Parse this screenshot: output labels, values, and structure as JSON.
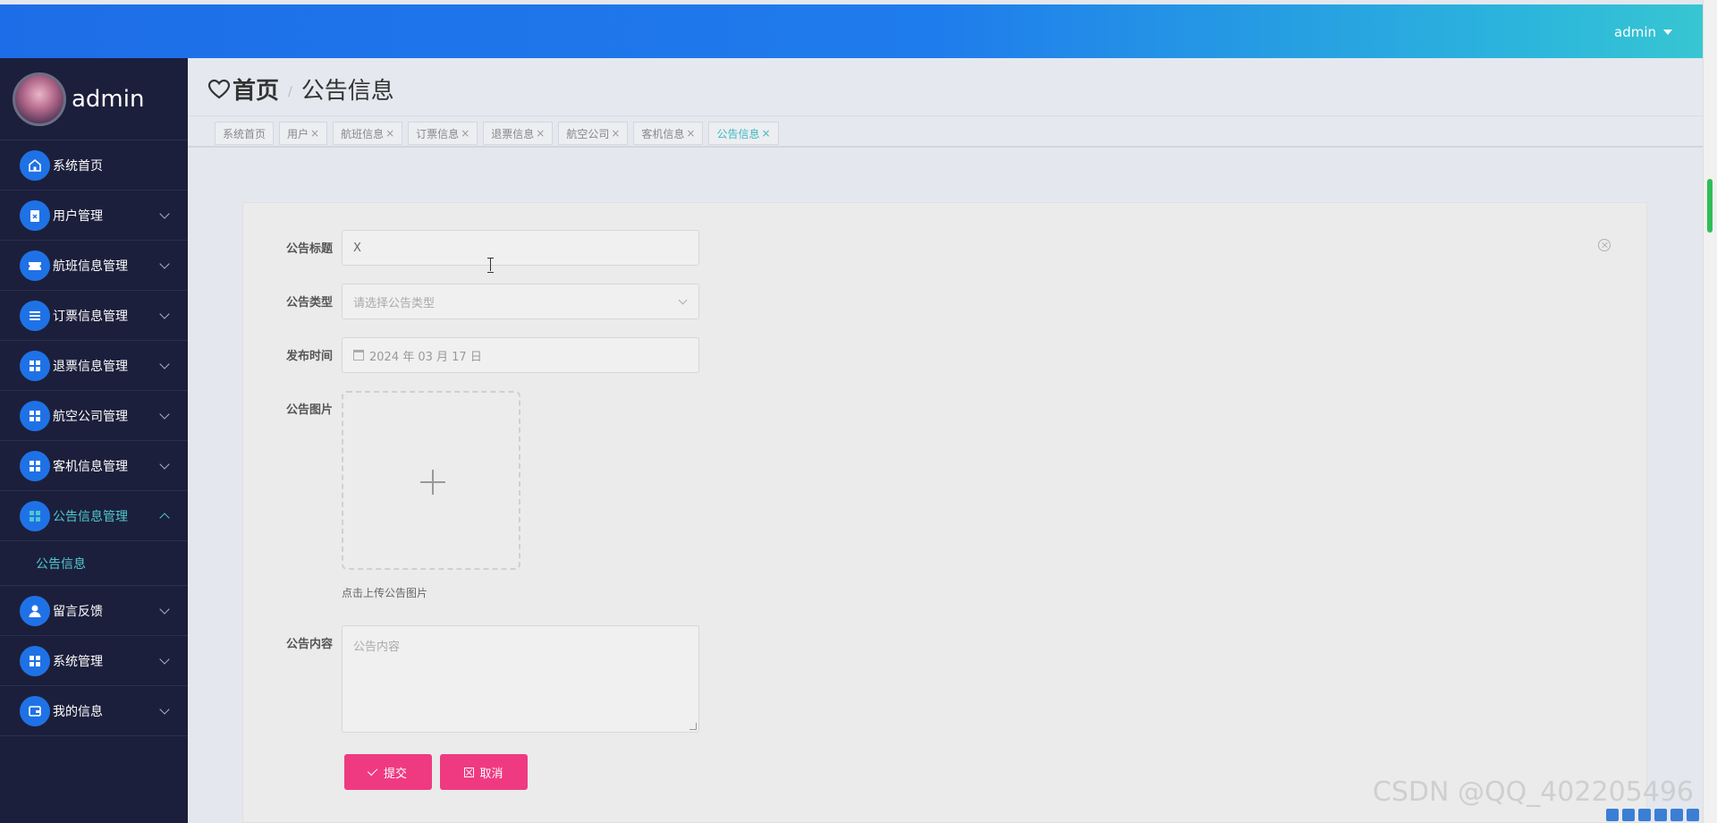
{
  "topbar": {
    "username": "admin"
  },
  "sidebar": {
    "profile_name": "admin",
    "items": [
      {
        "label": "系统首页",
        "icon": "home-icon",
        "expandable": false
      },
      {
        "label": "用户管理",
        "icon": "clipboard-icon",
        "expandable": true
      },
      {
        "label": "航班信息管理",
        "icon": "ticket-icon",
        "expandable": true
      },
      {
        "label": "订票信息管理",
        "icon": "list-icon",
        "expandable": true
      },
      {
        "label": "退票信息管理",
        "icon": "grid-icon",
        "expandable": true
      },
      {
        "label": "航空公司管理",
        "icon": "grid-icon",
        "expandable": true
      },
      {
        "label": "客机信息管理",
        "icon": "grid-icon",
        "expandable": true
      },
      {
        "label": "公告信息管理",
        "icon": "grid-icon",
        "expandable": true,
        "expanded": true
      },
      {
        "label": "留言反馈",
        "icon": "user-icon",
        "expandable": true
      },
      {
        "label": "系统管理",
        "icon": "grid-icon",
        "expandable": true
      },
      {
        "label": "我的信息",
        "icon": "wallet-icon",
        "expandable": true
      }
    ],
    "submenu": {
      "label": "公告信息"
    }
  },
  "breadcrumb": {
    "home": "首页",
    "separator": "/",
    "current": "公告信息"
  },
  "tags": [
    {
      "label": "系统首页",
      "closable": false
    },
    {
      "label": "用户",
      "closable": true
    },
    {
      "label": "航班信息",
      "closable": true
    },
    {
      "label": "订票信息",
      "closable": true
    },
    {
      "label": "退票信息",
      "closable": true
    },
    {
      "label": "航空公司",
      "closable": true
    },
    {
      "label": "客机信息",
      "closable": true
    },
    {
      "label": "公告信息",
      "closable": true,
      "active": true
    }
  ],
  "form": {
    "title_label": "公告标题",
    "title_value": "X",
    "type_label": "公告类型",
    "type_placeholder": "请选择公告类型",
    "time_label": "发布时间",
    "time_value": "2024 年 03 月 17 日",
    "image_label": "公告图片",
    "upload_tip": "点击上传公告图片",
    "content_label": "公告内容",
    "content_placeholder": "公告内容",
    "submit_label": "提交",
    "cancel_label": "取消"
  },
  "watermark": "CSDN @QQ_402205496",
  "colors": {
    "primary": "#1f72e6",
    "accent": "#4ec9cf",
    "button": "#ef3a82",
    "sidebar_bg": "#1c1f3b"
  }
}
